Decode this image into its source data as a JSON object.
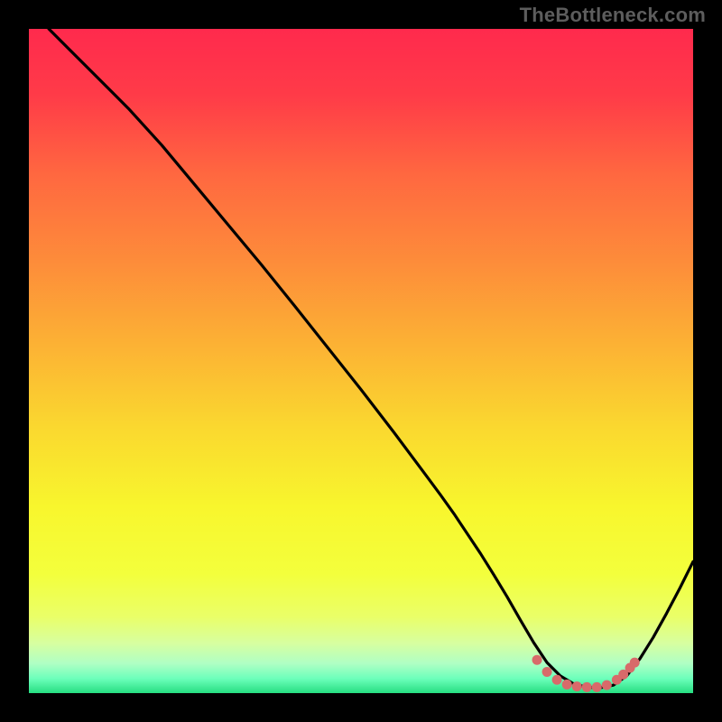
{
  "watermark": "TheBottleneck.com",
  "gradient": {
    "stops": [
      {
        "offset": 0.0,
        "color": "#ff2a4d"
      },
      {
        "offset": 0.1,
        "color": "#ff3b48"
      },
      {
        "offset": 0.22,
        "color": "#ff6840"
      },
      {
        "offset": 0.35,
        "color": "#fd8c3a"
      },
      {
        "offset": 0.48,
        "color": "#fcb334"
      },
      {
        "offset": 0.6,
        "color": "#fad82f"
      },
      {
        "offset": 0.72,
        "color": "#f8f62d"
      },
      {
        "offset": 0.82,
        "color": "#f3ff3c"
      },
      {
        "offset": 0.885,
        "color": "#eaff68"
      },
      {
        "offset": 0.925,
        "color": "#d7ffa0"
      },
      {
        "offset": 0.955,
        "color": "#b0ffc4"
      },
      {
        "offset": 0.978,
        "color": "#6dffbb"
      },
      {
        "offset": 1.0,
        "color": "#26de81"
      }
    ]
  },
  "chart_data": {
    "type": "line",
    "title": "",
    "xlabel": "",
    "ylabel": "",
    "xlim": [
      0,
      100
    ],
    "ylim": [
      0,
      100
    ],
    "series": [
      {
        "name": "bottleneck-curve",
        "x": [
          3,
          6,
          10,
          15,
          20,
          25,
          30,
          35,
          40,
          45,
          50,
          55,
          60,
          62,
          64,
          66,
          68,
          70,
          72,
          74,
          76,
          78,
          80,
          82,
          84,
          86,
          88,
          90,
          92,
          94,
          96,
          98,
          100
        ],
        "y": [
          100,
          97,
          93,
          88,
          82.5,
          76.5,
          70.5,
          64.5,
          58.3,
          52,
          45.7,
          39.2,
          32.5,
          29.8,
          27,
          24,
          21,
          17.8,
          14.5,
          11,
          7.6,
          4.6,
          2.6,
          1.4,
          0.9,
          0.8,
          1.2,
          2.6,
          5.2,
          8.4,
          12,
          15.8,
          19.8
        ]
      }
    ],
    "markers": {
      "name": "bottom-dots",
      "color": "#d86a6a",
      "points": [
        {
          "x": 76.5,
          "y": 5.0
        },
        {
          "x": 78.0,
          "y": 3.2
        },
        {
          "x": 79.5,
          "y": 2.0
        },
        {
          "x": 81.0,
          "y": 1.3
        },
        {
          "x": 82.5,
          "y": 1.0
        },
        {
          "x": 84.0,
          "y": 0.9
        },
        {
          "x": 85.5,
          "y": 0.9
        },
        {
          "x": 87.0,
          "y": 1.2
        },
        {
          "x": 88.5,
          "y": 2.0
        },
        {
          "x": 89.5,
          "y": 2.8
        },
        {
          "x": 90.5,
          "y": 3.8
        },
        {
          "x": 91.2,
          "y": 4.6
        }
      ]
    }
  }
}
